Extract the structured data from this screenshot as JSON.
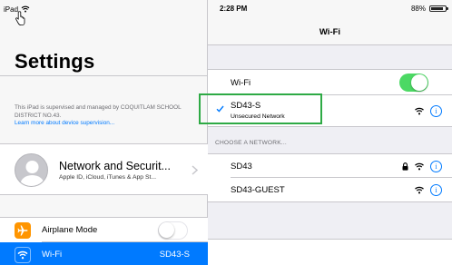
{
  "status_bar": {
    "device": "iPad",
    "time": "2:28 PM",
    "battery": "88%",
    "battery_level": 0.88
  },
  "master": {
    "title": "Settings",
    "supervision_text": "This iPad is supervised and managed by COQUITLAM SCHOOL DISTRICT NO.43.",
    "supervision_link": "Learn more about device supervision...",
    "account": {
      "name": "Network and Securit...",
      "subtitle": "Apple ID, iCloud, iTunes & App St..."
    },
    "rows": [
      {
        "label": "Airplane Mode",
        "icon": "airplane-icon",
        "toggle": "off"
      },
      {
        "label": "Wi-Fi",
        "icon": "wifi-icon",
        "value": "SD43-S",
        "selected": true
      }
    ]
  },
  "detail": {
    "title": "Wi-Fi",
    "wifi_label": "Wi-Fi",
    "wifi_toggle": "on",
    "connected": {
      "name": "SD43-S",
      "subtitle": "Unsecured Network"
    },
    "section_header": "CHOOSE A NETWORK...",
    "networks": [
      {
        "name": "SD43",
        "locked": true
      },
      {
        "name": "SD43-GUEST",
        "locked": false
      }
    ]
  },
  "colors": {
    "accent": "#007aff",
    "toggle_on": "#4cd964",
    "airplane": "#ff9500",
    "highlight": "#2eaa45"
  }
}
